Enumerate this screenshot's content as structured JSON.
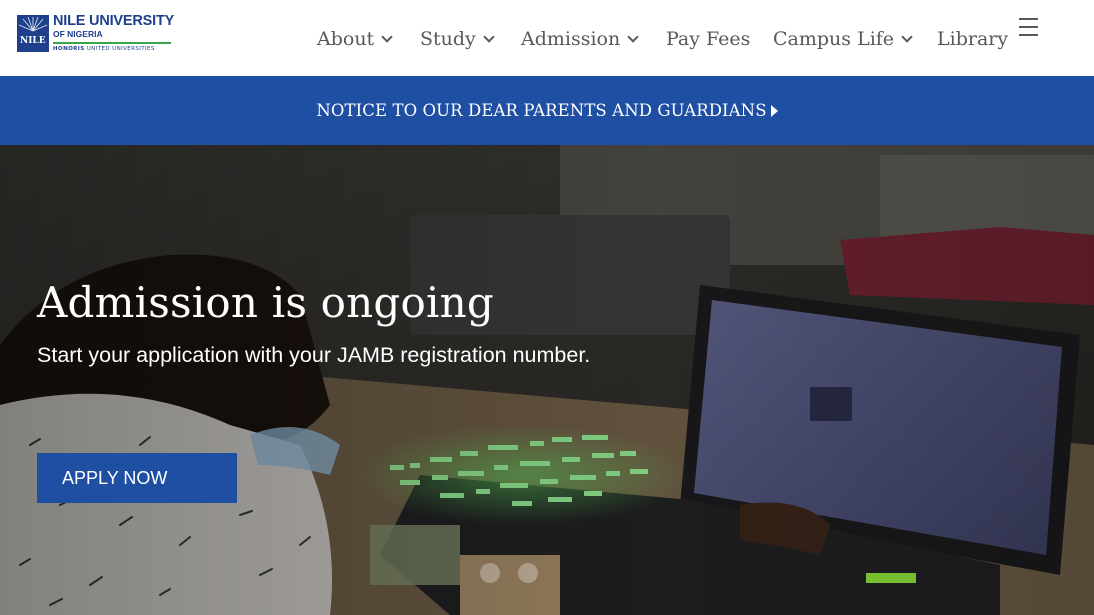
{
  "header": {
    "logo": {
      "name": "NILE UNIVERSITY",
      "sub": "OF NIGERIA",
      "badge": "NILE",
      "motto_bold": "HONORIS",
      "motto_rest": " UNITED UNIVERSITIES"
    },
    "nav": [
      {
        "label": "About",
        "has_dropdown": true
      },
      {
        "label": "Study",
        "has_dropdown": true
      },
      {
        "label": "Admission",
        "has_dropdown": true
      },
      {
        "label": "Pay Fees",
        "has_dropdown": false
      },
      {
        "label": "Campus Life",
        "has_dropdown": true
      },
      {
        "label": "Library",
        "has_dropdown": false
      }
    ],
    "menu_icon": "hamburger-icon"
  },
  "notice": {
    "text": "NOTICE TO OUR DEAR PARENTS AND GUARDIANS",
    "icon": "caret-right-icon"
  },
  "hero": {
    "title": "Admission is ongoing",
    "subtitle": "Start your application with your JAMB registration number.",
    "cta_label": "APPLY NOW"
  },
  "colors": {
    "brand_blue": "#1f4fa3",
    "logo_blue": "#1d3f8c",
    "logo_green": "#3aa64a",
    "nav_text": "#55595f"
  }
}
